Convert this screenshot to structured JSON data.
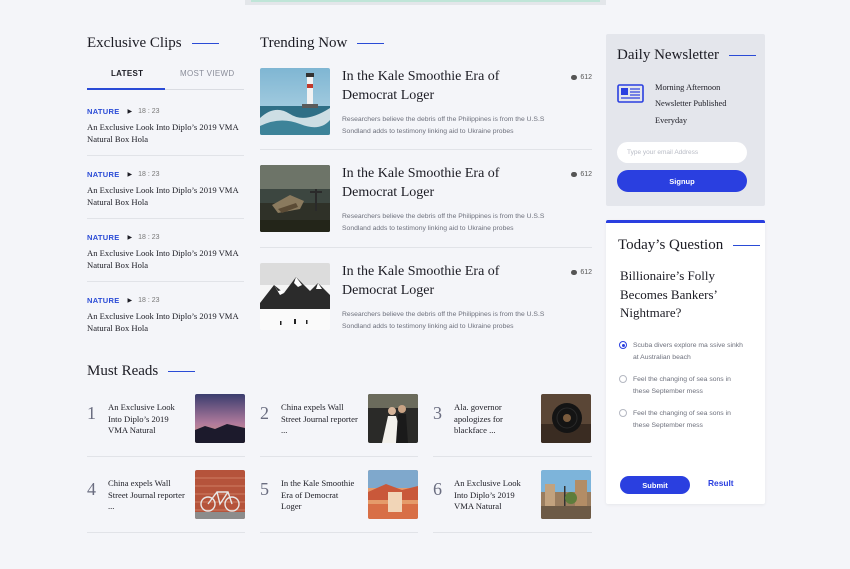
{
  "exclusive": {
    "title": "Exclusive Clips",
    "tabs": [
      "LATEST",
      "MOST VIEWD"
    ],
    "items": [
      {
        "category": "NATURE",
        "time": "18 : 23",
        "title": "An Exclusive Look Into Diplo’s 2019 VMA Natural Box Hola"
      },
      {
        "category": "NATURE",
        "time": "18 : 23",
        "title": "An Exclusive Look Into Diplo’s 2019 VMA Natural Box Hola"
      },
      {
        "category": "NATURE",
        "time": "18 : 23",
        "title": "An Exclusive Look Into Diplo’s 2019 VMA Natural Box Hola"
      },
      {
        "category": "NATURE",
        "time": "18 : 23",
        "title": "An Exclusive Look Into Diplo’s 2019 VMA Natural Box Hola"
      }
    ]
  },
  "trending": {
    "title": "Trending Now",
    "items": [
      {
        "title": "In the Kale Smoothie Era of Democrat Loger",
        "desc": "Researchers believe the debris off the Philippines is from the U.S.S Sondland adds to testimony linking aid to Ukraine probes",
        "comments": "612",
        "image": "lighthouse-wave"
      },
      {
        "title": "In the Kale Smoothie Era of Democrat Loger",
        "desc": "Researchers believe the debris off the Philippines is from the U.S.S Sondland adds to testimony linking aid to Ukraine probes",
        "comments": "612",
        "image": "shipwreck-shore"
      },
      {
        "title": "In the Kale Smoothie Era of Democrat Loger",
        "desc": "Researchers believe the debris off the Philippines is from the U.S.S Sondland adds to testimony linking aid to Ukraine probes",
        "comments": "612",
        "image": "snowy-mountain"
      }
    ]
  },
  "must_reads": {
    "title": "Must Reads",
    "items": [
      {
        "num": "1",
        "title": "An Exclusive Look Into Diplo’s 2019 VMA Natural",
        "image": "purple-sunset"
      },
      {
        "num": "2",
        "title": "China expels Wall Street Journal reporter ...",
        "image": "wedding-couple"
      },
      {
        "num": "3",
        "title": "Ala. governor apologizes for blackface ...",
        "image": "vinyl-record"
      },
      {
        "num": "4",
        "title": "China expels Wall Street Journal reporter ...",
        "image": "bicycle-brick-wall"
      },
      {
        "num": "5",
        "title": "In the Kale Smoothie Era of Democrat Loger",
        "image": "painted-landscape"
      },
      {
        "num": "6",
        "title": "An Exclusive Look Into Diplo’s 2019 VMA Natural",
        "image": "city-street"
      }
    ]
  },
  "newsletter": {
    "title": "Daily Newsletter",
    "text": "Morning Afternoon Newsletter Published Everyday",
    "placeholder": "Type your email Address",
    "button": "Signup",
    "icon": "newspaper-icon"
  },
  "question": {
    "title": "Today’s Question",
    "text": "Billionaire’s Folly Becomes Bankers’ Nightmare?",
    "options": [
      {
        "text": "Scuba divers explore ma ssive sinkh at Australian beach",
        "selected": true
      },
      {
        "text": "Feel the changing of sea sons in these September mess",
        "selected": false
      },
      {
        "text": "Feel the changing of sea sons in these September mess",
        "selected": false
      }
    ],
    "submit": "Submit",
    "result": "Result"
  },
  "colors": {
    "accent": "#2a3fe0",
    "background": "#f4f5f9"
  }
}
